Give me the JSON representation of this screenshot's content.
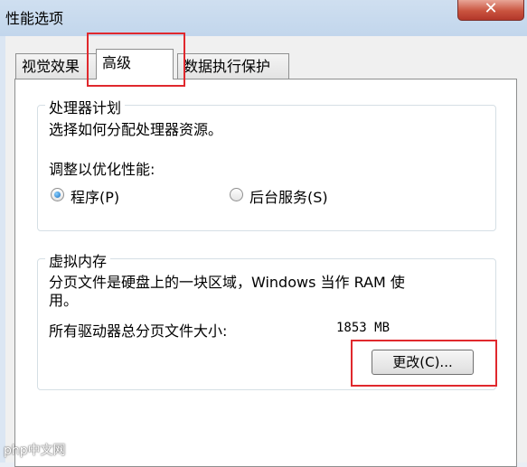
{
  "window": {
    "title": "性能选项",
    "close_label": "✕"
  },
  "tabs": [
    {
      "label": "视觉效果",
      "active": false
    },
    {
      "label": "高级",
      "active": true
    },
    {
      "label": "数据执行保护",
      "active": false
    }
  ],
  "processor": {
    "legend": "处理器计划",
    "description": "选择如何分配处理器资源。",
    "adjust_label": "调整以优化性能:",
    "options": [
      {
        "label": "程序(P)",
        "selected": true
      },
      {
        "label": "后台服务(S)",
        "selected": false
      }
    ]
  },
  "virtual_memory": {
    "legend": "虚拟内存",
    "description_line1": "分页文件是硬盘上的一块区域，Windows 当作 RAM 使",
    "description_line2": "用。",
    "total_label": "所有驱动器总分页文件大小:",
    "total_value": "1853 MB",
    "change_button": "更改(C)..."
  },
  "watermark": "php中文网",
  "colors": {
    "highlight": "#e0282d",
    "close_button": "#c9543f"
  }
}
